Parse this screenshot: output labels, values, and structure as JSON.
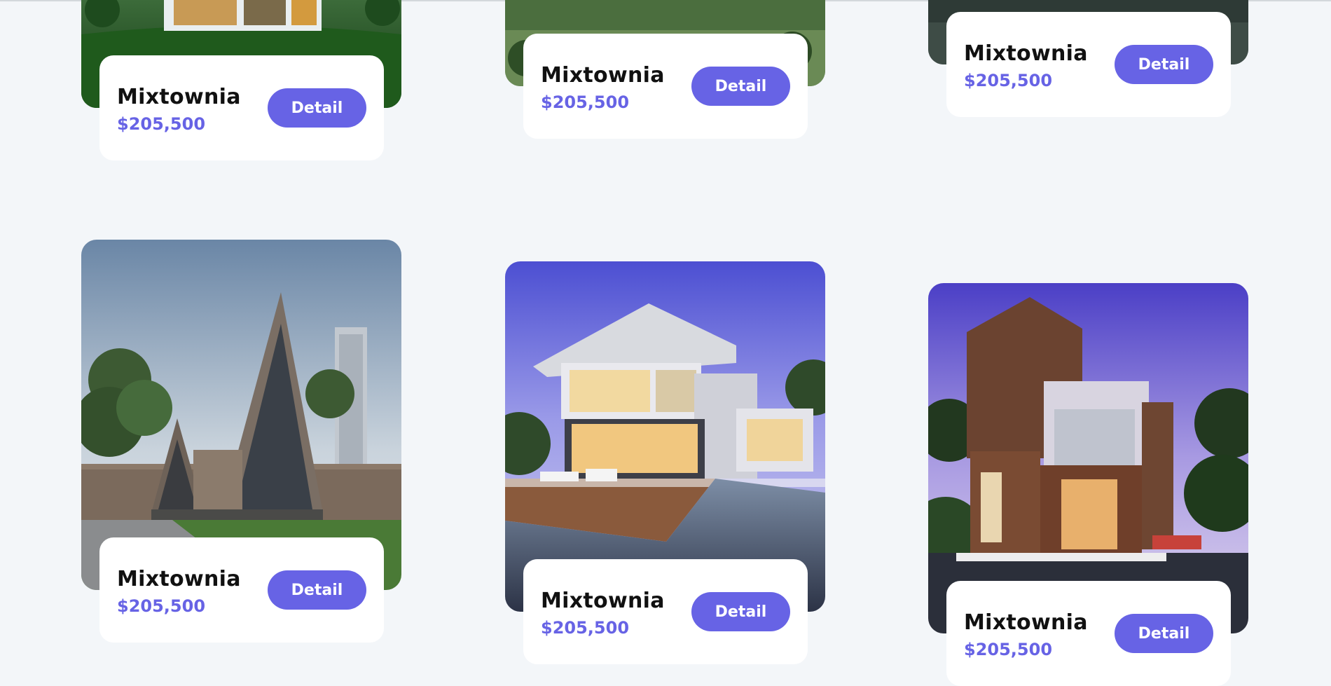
{
  "listings": [
    {
      "name": "Mixtownia",
      "price": "$205,500",
      "button_label": "Detail"
    },
    {
      "name": "Mixtownia",
      "price": "$205,500",
      "button_label": "Detail"
    },
    {
      "name": "Mixtownia",
      "price": "$205,500",
      "button_label": "Detail"
    },
    {
      "name": "Mixtownia",
      "price": "$205,500",
      "button_label": "Detail"
    },
    {
      "name": "Mixtownia",
      "price": "$205,500",
      "button_label": "Detail"
    },
    {
      "name": "Mixtownia",
      "price": "$205,500",
      "button_label": "Detail"
    }
  ],
  "colors": {
    "accent": "#6763e5",
    "background": "#f3f6f9",
    "card": "#ffffff"
  }
}
